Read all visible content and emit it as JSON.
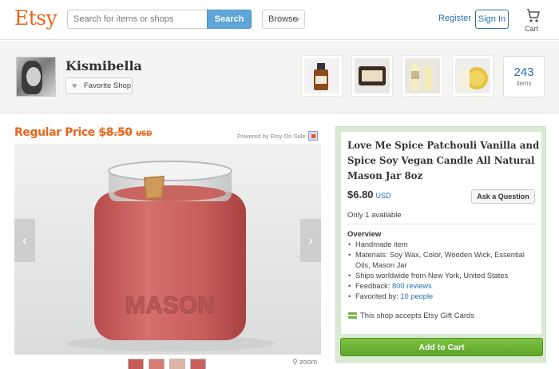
{
  "header": {
    "logo": "Etsy",
    "search_placeholder": "Search for items or shops",
    "search_button": "Search",
    "browse_label": "Browse",
    "register": "Register",
    "sign_in": "Sign In",
    "cart_label": "Cart"
  },
  "shop": {
    "name": "Kismibella",
    "favorite_label": "Favorite Shop",
    "items_count": "243",
    "items_label": "items",
    "featured_thumbs": [
      "dropper-bottle",
      "candle-tin",
      "lip-balm-tubes",
      "candle-jar-lid"
    ]
  },
  "listing": {
    "regular_price_label": "Regular Price",
    "regular_price_value": "$8.50",
    "regular_price_currency": "USD",
    "powered_by": "Powered by Etsy On Sale",
    "title": "Love Me Spice Patchouli Vanilla and Spice Soy Vegan Candle All Natural Mason Jar 8oz",
    "price": "$6.80",
    "currency": "USD",
    "ask_question": "Ask a Question",
    "availability": "Only 1 available",
    "overview_heading": "Overview",
    "overview": {
      "handmade": "Handmade item",
      "materials": "Materials: Soy Wax, Color, Wooden Wick, Essential Oils, Mason Jar",
      "ships": "Ships worldwide from New York, United States",
      "feedback_prefix": "Feedback:",
      "feedback_link": "800 reviews",
      "favorited_prefix": "Favorited by:",
      "favorited_link": "10 people"
    },
    "gift_cards": "This shop accepts Etsy Gift Cards",
    "add_to_cart": "Add to Cart",
    "zoom_label": "zoom",
    "image_embossed_text": "MASON"
  },
  "colors": {
    "brand_orange": "#e8661c",
    "link_blue": "#2a6eb7",
    "cart_green": "#6bb236",
    "panel_green": "#d9ead3"
  }
}
